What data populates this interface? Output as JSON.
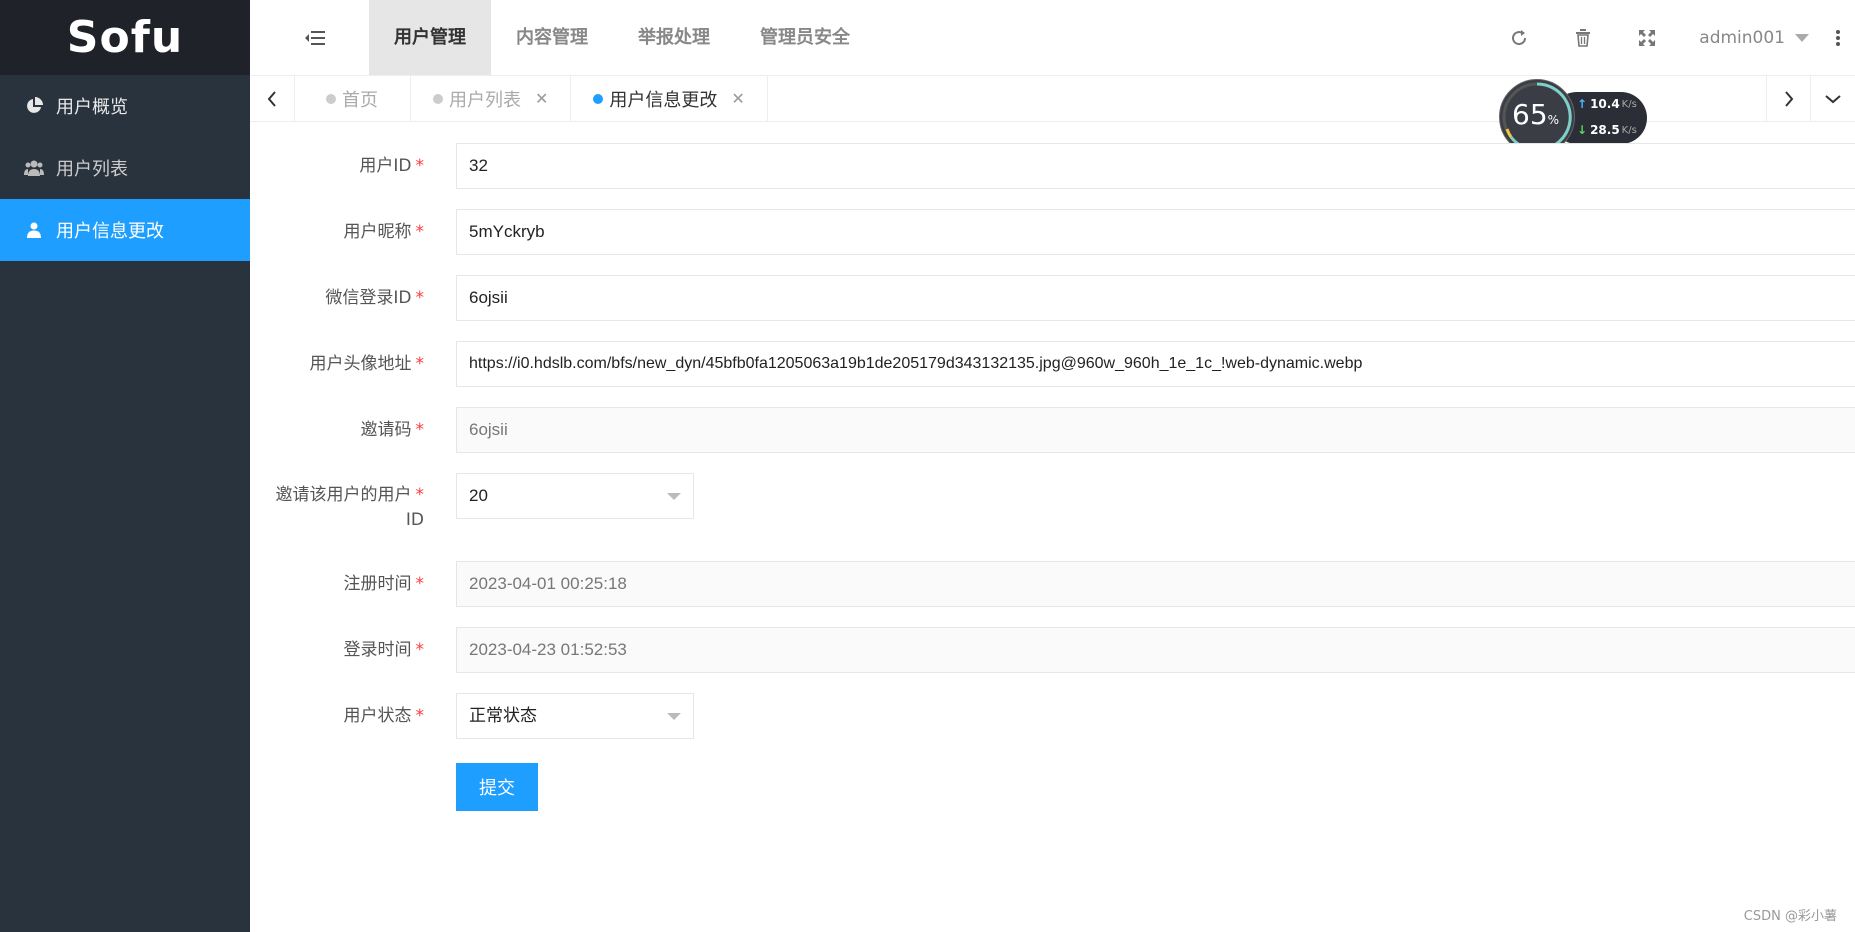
{
  "sidebar": {
    "logo": "Sofu",
    "items": [
      {
        "label": "用户概览",
        "icon": "pie-chart-icon"
      },
      {
        "label": "用户列表",
        "icon": "users-icon"
      },
      {
        "label": "用户信息更改",
        "icon": "user-icon",
        "active": true
      }
    ]
  },
  "header": {
    "nav": [
      "用户管理",
      "内容管理",
      "举报处理",
      "管理员安全"
    ],
    "active_nav": "用户管理",
    "user": "admin001"
  },
  "tabs": [
    {
      "label": "首页"
    },
    {
      "label": "用户列表"
    },
    {
      "label": "用户信息更改",
      "active": true
    }
  ],
  "speed_widget": {
    "percent": "65",
    "percent_unit": "%",
    "up": "10.4",
    "down": "28.5",
    "unit": "K/s"
  },
  "form": {
    "user_id": {
      "label": "用户ID",
      "value": "32"
    },
    "nickname": {
      "label": "用户昵称",
      "value": "5mYckryb"
    },
    "wechat_id": {
      "label": "微信登录ID",
      "value": "6ojsii"
    },
    "avatar": {
      "label": "用户头像地址",
      "value": "https://i0.hdslb.com/bfs/new_dyn/45bfb0fa1205063a19b1de205179d343132135.jpg@960w_960h_1e_1c_!web-dynamic.webp"
    },
    "invite_code": {
      "label": "邀请码",
      "value": "6ojsii"
    },
    "inviter_id": {
      "label_line1": "邀请该用户的用户",
      "label_line2": "ID",
      "value": "20"
    },
    "register_time": {
      "label": "注册时间",
      "value": "2023-04-01 00:25:18"
    },
    "login_time": {
      "label": "登录时间",
      "value": "2023-04-23 01:52:53"
    },
    "status": {
      "label": "用户状态",
      "value": "正常状态"
    },
    "required_mark": "*",
    "submit": "提交"
  },
  "watermark": "CSDN @彩小薯",
  "colors": {
    "accent": "#1e9fff",
    "sidebar": "#28333e",
    "logo_bg": "#20222a",
    "required": "#ff3b3b"
  }
}
